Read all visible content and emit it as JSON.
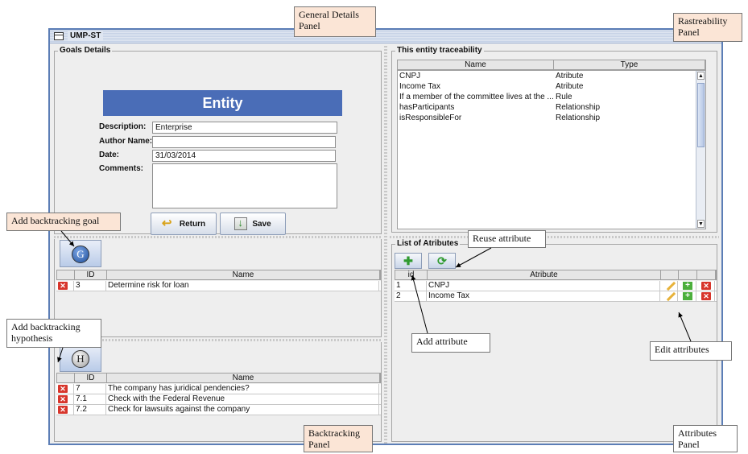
{
  "window": {
    "title": "UMP-ST"
  },
  "goals_details": {
    "legend": "Goals Details",
    "banner": "Entity",
    "description_label": "Description:",
    "description_value": "Enterprise",
    "author_label": "Author Name:",
    "author_value": "",
    "date_label": "Date:",
    "date_value": "31/03/2014",
    "comments_label": "Comments:",
    "comments_value": "",
    "return_label": "Return",
    "save_label": "Save"
  },
  "traceability": {
    "legend": "This entity traceability",
    "headers": [
      "Name",
      "Type"
    ],
    "rows": [
      {
        "name": "CNPJ",
        "type": "Atribute"
      },
      {
        "name": "Income Tax",
        "type": "Atribute"
      },
      {
        "name": "If a member of the committee lives at the ...",
        "type": "Rule"
      },
      {
        "name": "hasParticipants",
        "type": "Relationship"
      },
      {
        "name": "isResponsibleFor",
        "type": "Relationship"
      }
    ]
  },
  "goal_backtracking": {
    "button_letter": "G",
    "headers": [
      "ID",
      "Name"
    ],
    "rows": [
      {
        "id": "3",
        "name": "Determine risk for loan"
      }
    ]
  },
  "hypothesis_backtracking": {
    "button_letter": "H",
    "headers": [
      "ID",
      "Name"
    ],
    "rows": [
      {
        "id": "7",
        "name": "The company has juridical pendencies?"
      },
      {
        "id": "7.1",
        "name": "Check with the Federal Revenue"
      },
      {
        "id": "7.2",
        "name": "Check for lawsuits against the company"
      }
    ]
  },
  "attributes": {
    "legend": "List of Atributes",
    "headers": [
      "id",
      "Atribute"
    ],
    "rows": [
      {
        "id": "1",
        "name": "CNPJ"
      },
      {
        "id": "2",
        "name": "Income Tax"
      }
    ]
  },
  "callouts": {
    "general": "General Details Panel",
    "traceability": "Rastreability Panel",
    "add_goal": "Add backtracking  goal",
    "add_hypothesis": "Add backtracking hypothesis",
    "reuse": "Reuse  attribute",
    "add_attribute": "Add attribute",
    "edit": "Edit  attributes",
    "backtracking": "Backtracking Panel",
    "attributes": "Attributes Panel"
  },
  "colors": {
    "banner": "#4a6db7",
    "frame": "#5c7eb6",
    "callout": "#fbe5d6",
    "delete": "#d7352b",
    "add": "#4caf3c"
  }
}
